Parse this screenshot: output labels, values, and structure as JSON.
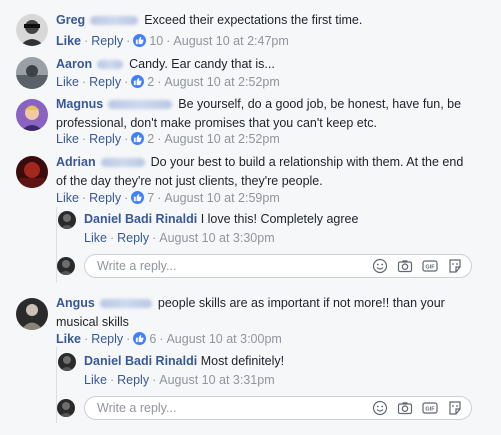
{
  "comments": [
    {
      "name": "Greg",
      "text": "Exceed their expectations the first time.",
      "like": "Like",
      "reply": "Reply",
      "reactions": "10",
      "time": "August 10 at 2:47pm",
      "avatar_color": "#555"
    },
    {
      "name": "Aaron",
      "text": "Candy. Ear candy that is...",
      "like": "Like",
      "reply": "Reply",
      "reactions": "2",
      "time": "August 10 at 2:52pm",
      "avatar_color": "#777"
    },
    {
      "name": "Magnus",
      "text_line1": "Be yourself, do a good job, be honest, have fun, be",
      "text_line2": "professional, don't make promises that you can't keep etc.",
      "like": "Like",
      "reply": "Reply",
      "reactions": "2",
      "time": "August 10 at 2:52pm",
      "avatar_color": "#7a5aa8"
    },
    {
      "name": "Adrian",
      "text_line1": "Do your best to build a relationship with them. At the end",
      "text_line2": "of the day they're not just clients, they're people.",
      "like": "Like",
      "reply": "Reply",
      "reactions": "7",
      "time": "August 10 at 2:59pm",
      "avatar_color": "#8a1c1c",
      "reply_item": {
        "name": "Daniel Badi Rinaldi",
        "text": "I love this! Completely agree",
        "like": "Like",
        "reply": "Reply",
        "time": "August 10 at 3:30pm"
      }
    },
    {
      "name": "Angus",
      "text_line1": "people skills are as important if not more!! than your",
      "text_line2": "musical skills",
      "like": "Like",
      "reply": "Reply",
      "reactions": "6",
      "time": "August 10 at 3:00pm",
      "avatar_color": "#444",
      "reply_item": {
        "name": "Daniel Badi Rinaldi",
        "text": "Most definitely!",
        "like": "Like",
        "reply": "Reply",
        "time": "August 10 at 3:31pm"
      }
    }
  ],
  "reply_placeholder": "Write a reply...",
  "colors": {
    "link": "#385898",
    "meta": "#90949c",
    "like_badge": "#4080ff"
  }
}
